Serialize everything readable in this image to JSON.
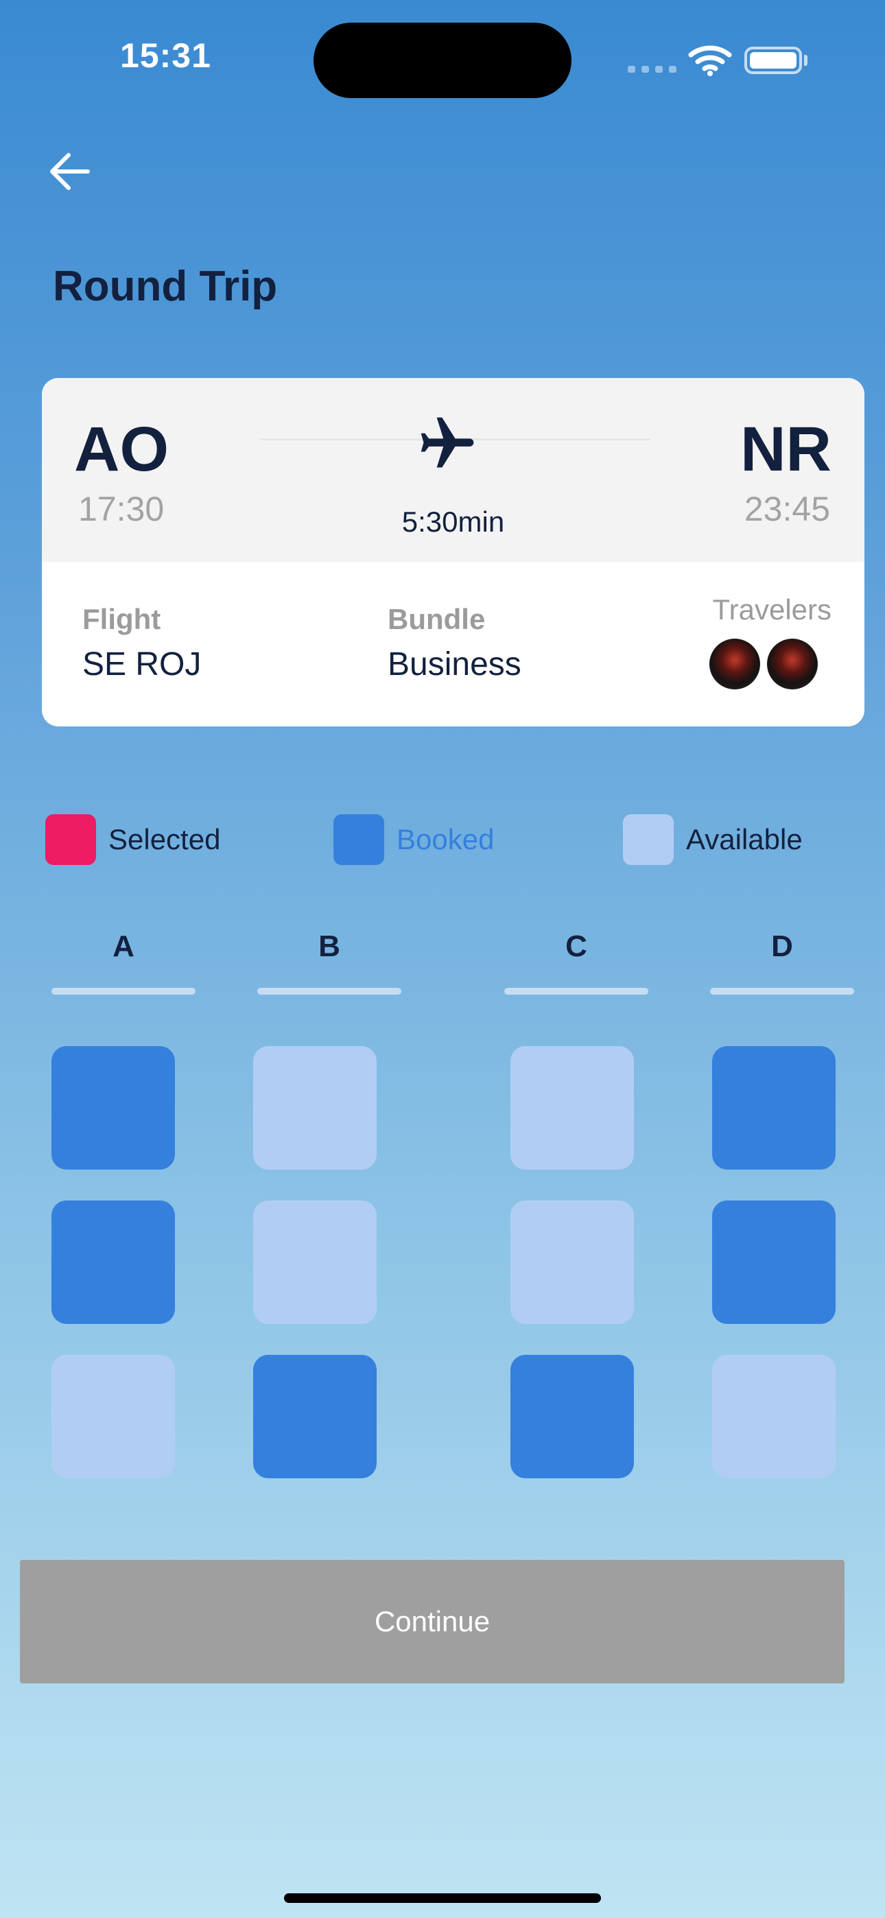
{
  "status_bar": {
    "time": "15:31"
  },
  "header": {
    "title": "Round Trip",
    "back_icon": "arrow-left-icon"
  },
  "trip": {
    "from_code": "AO",
    "from_time": "17:30",
    "to_code": "NR",
    "to_time": "23:45",
    "duration": "5:30min",
    "flight_label": "Flight",
    "flight_value": "SE ROJ",
    "bundle_label": "Bundle",
    "bundle_value": "Business",
    "travelers_label": "Travelers",
    "traveler_count": 2
  },
  "legend": [
    {
      "label": "Selected",
      "color": "#ee1c63",
      "text_color": "#13213f"
    },
    {
      "label": "Booked",
      "color": "#3580dd",
      "text_color": "#3580dd"
    },
    {
      "label": "Available",
      "color": "#b2cdf4",
      "text_color": "#13213f"
    }
  ],
  "seat_columns": [
    "A",
    "B",
    "C",
    "D"
  ],
  "seat_rows": [
    [
      "booked",
      "available",
      "available",
      "booked"
    ],
    [
      "booked",
      "available",
      "available",
      "booked"
    ],
    [
      "available",
      "booked",
      "booked",
      "available"
    ]
  ],
  "colors": {
    "booked": "#3580dd",
    "available": "#b2cdf4",
    "selected": "#ee1c63",
    "continue_disabled": "#9f9f9f"
  },
  "continue_label": "Continue"
}
